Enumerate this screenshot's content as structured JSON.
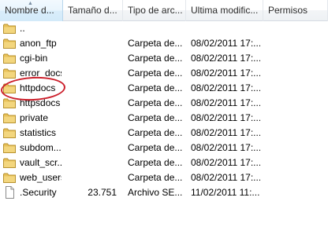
{
  "columns": {
    "name": "Nombre d...",
    "size": "Tamaño d...",
    "type": "Tipo de arc...",
    "modified": "Ultima modific...",
    "permissions": "Permisos"
  },
  "rows": [
    {
      "name": "..",
      "size": "",
      "type": "",
      "modified": "",
      "icon": "folder-icon"
    },
    {
      "name": "anon_ftp",
      "size": "",
      "type": "Carpeta de...",
      "modified": "08/02/2011 17:...",
      "icon": "folder-icon"
    },
    {
      "name": "cgi-bin",
      "size": "",
      "type": "Carpeta de...",
      "modified": "08/02/2011 17:...",
      "icon": "folder-icon"
    },
    {
      "name": "error_docs",
      "size": "",
      "type": "Carpeta de...",
      "modified": "08/02/2011 17:...",
      "icon": "folder-icon"
    },
    {
      "name": "httpdocs",
      "size": "",
      "type": "Carpeta de...",
      "modified": "08/02/2011 17:...",
      "icon": "folder-icon"
    },
    {
      "name": "httpsdocs",
      "size": "",
      "type": "Carpeta de...",
      "modified": "08/02/2011 17:...",
      "icon": "folder-icon"
    },
    {
      "name": "private",
      "size": "",
      "type": "Carpeta de...",
      "modified": "08/02/2011 17:...",
      "icon": "folder-icon"
    },
    {
      "name": "statistics",
      "size": "",
      "type": "Carpeta de...",
      "modified": "08/02/2011 17:...",
      "icon": "folder-icon"
    },
    {
      "name": "subdom...",
      "size": "",
      "type": "Carpeta de...",
      "modified": "08/02/2011 17:...",
      "icon": "folder-icon"
    },
    {
      "name": "vault_scr...",
      "size": "",
      "type": "Carpeta de...",
      "modified": "08/02/2011 17:...",
      "icon": "folder-icon"
    },
    {
      "name": "web_users",
      "size": "",
      "type": "Carpeta de...",
      "modified": "08/02/2011 17:...",
      "icon": "folder-icon"
    },
    {
      "name": ".Security",
      "size": "23.751",
      "type": "Archivo SE...",
      "modified": "11/02/2011 11:...",
      "icon": "file-icon"
    }
  ],
  "highlight": {
    "target": "httpdocs",
    "color": "#cc1f2b"
  },
  "colors": {
    "folder": "#e8c15a",
    "header_sorted": "#d9edfa"
  }
}
